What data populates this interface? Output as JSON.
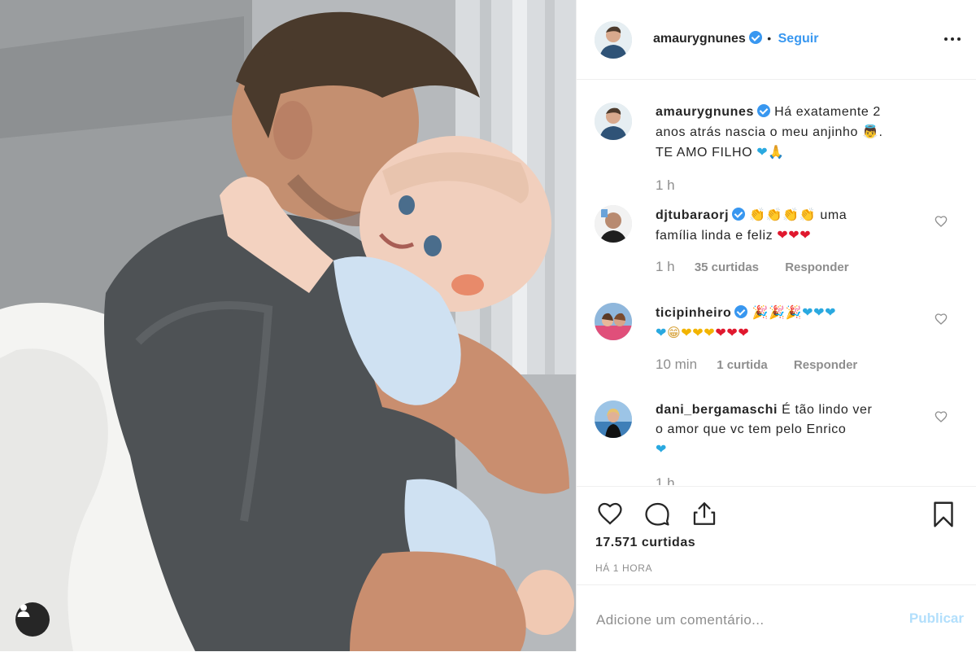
{
  "post": {
    "author": "amaurygnunes",
    "follow_label": "Seguir",
    "separator": "•",
    "caption": {
      "line1_pre": "Há exatamente 2",
      "line2": "anos atrás nascia o meu anjinho",
      "line3": "TE AMO FILHO",
      "time": "1 h"
    },
    "likes": "17.571 curtidas",
    "posted": "HÁ 1 HORA"
  },
  "comments": [
    {
      "username": "djtubaraorj",
      "verified": true,
      "emoji_prefix": "👏👏👏👏",
      "text_a": "uma",
      "text_b": "família linda e feliz",
      "emoji_suffix": "❤❤❤",
      "time": "1 h",
      "likes": "35 curtidas",
      "reply": "Responder"
    },
    {
      "username": "ticipinheiro",
      "verified": true,
      "emoji_line1_party": "🎉🎉🎉",
      "emoji_line1_hearts": "❤❤❤",
      "emoji_line2_blue": "❤",
      "emoji_line2_face": "😁",
      "emoji_line2_yellow": "❤❤❤",
      "emoji_line2_red": "❤❤❤",
      "time": "10 min",
      "likes": "1 curtida",
      "reply": "Responder"
    },
    {
      "username": "dani_bergamaschi",
      "verified": false,
      "text_a": "É tão lindo ver",
      "text_b": "o amor que vc tem pelo Enrico",
      "emoji_line3": "❤",
      "time": "1 h"
    }
  ],
  "add_comment": {
    "placeholder": "Adicione um comentário...",
    "publish": "Publicar"
  },
  "icons": {
    "like": "heart-icon",
    "comment": "comment-icon",
    "share": "share-icon",
    "save": "bookmark-icon",
    "tag_users": "user-tag-icon",
    "more": "more-options-icon"
  },
  "colors": {
    "link_blue": "#3897f0",
    "muted": "#8e8e8e",
    "publish_disabled": "#b2dffc"
  }
}
